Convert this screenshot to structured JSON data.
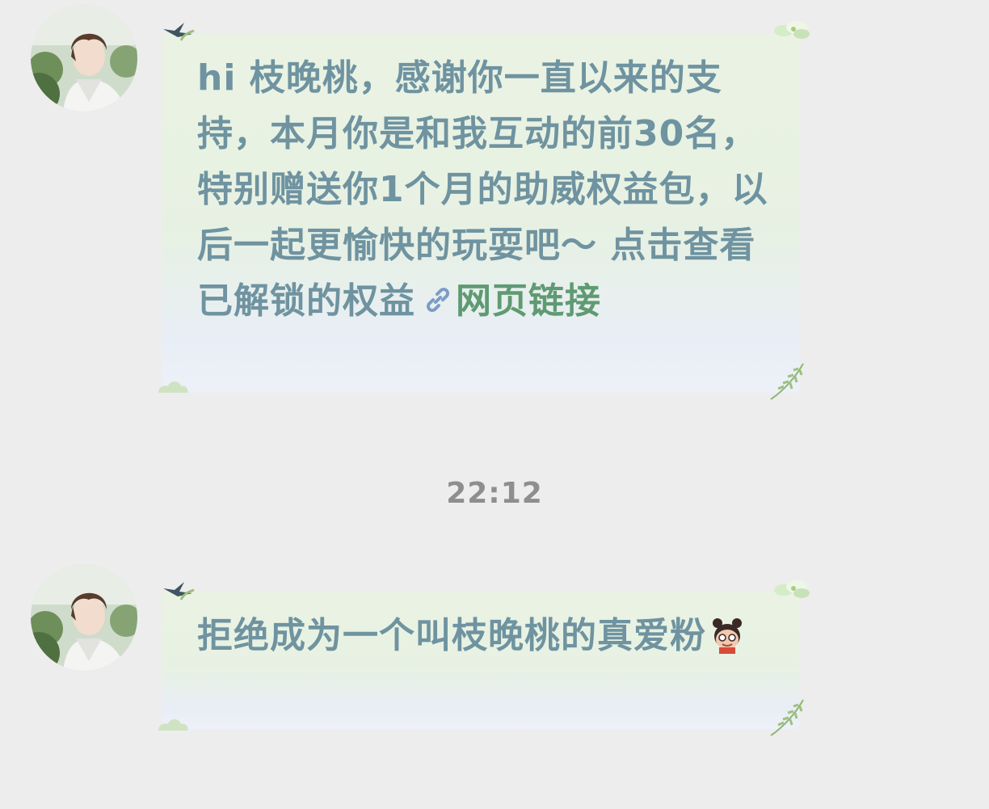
{
  "chat": {
    "messages": [
      {
        "sender_avatar_icon": "boy-portrait-avatar",
        "text": "hi 枝晚桃，感谢你一直以来的支持，本月你是和我互动的前30名，特别赠送你1个月的助威权益包，以后一起更愉快的玩耍吧～ 点击查看已解锁的权益",
        "link_icon": "link-icon",
        "link_label": "网页链接"
      },
      {
        "sender_avatar_icon": "boy-portrait-avatar",
        "text": "拒绝成为一个叫枝晚桃的真爱粉",
        "emoji_icon": "cartoon-girl-emoji"
      }
    ],
    "timestamp": "22:12"
  },
  "colors": {
    "background": "#ededed",
    "bubble_text": "#6f93a0",
    "link_text": "#5f9a72",
    "timestamp_text": "#8e8e8e"
  }
}
